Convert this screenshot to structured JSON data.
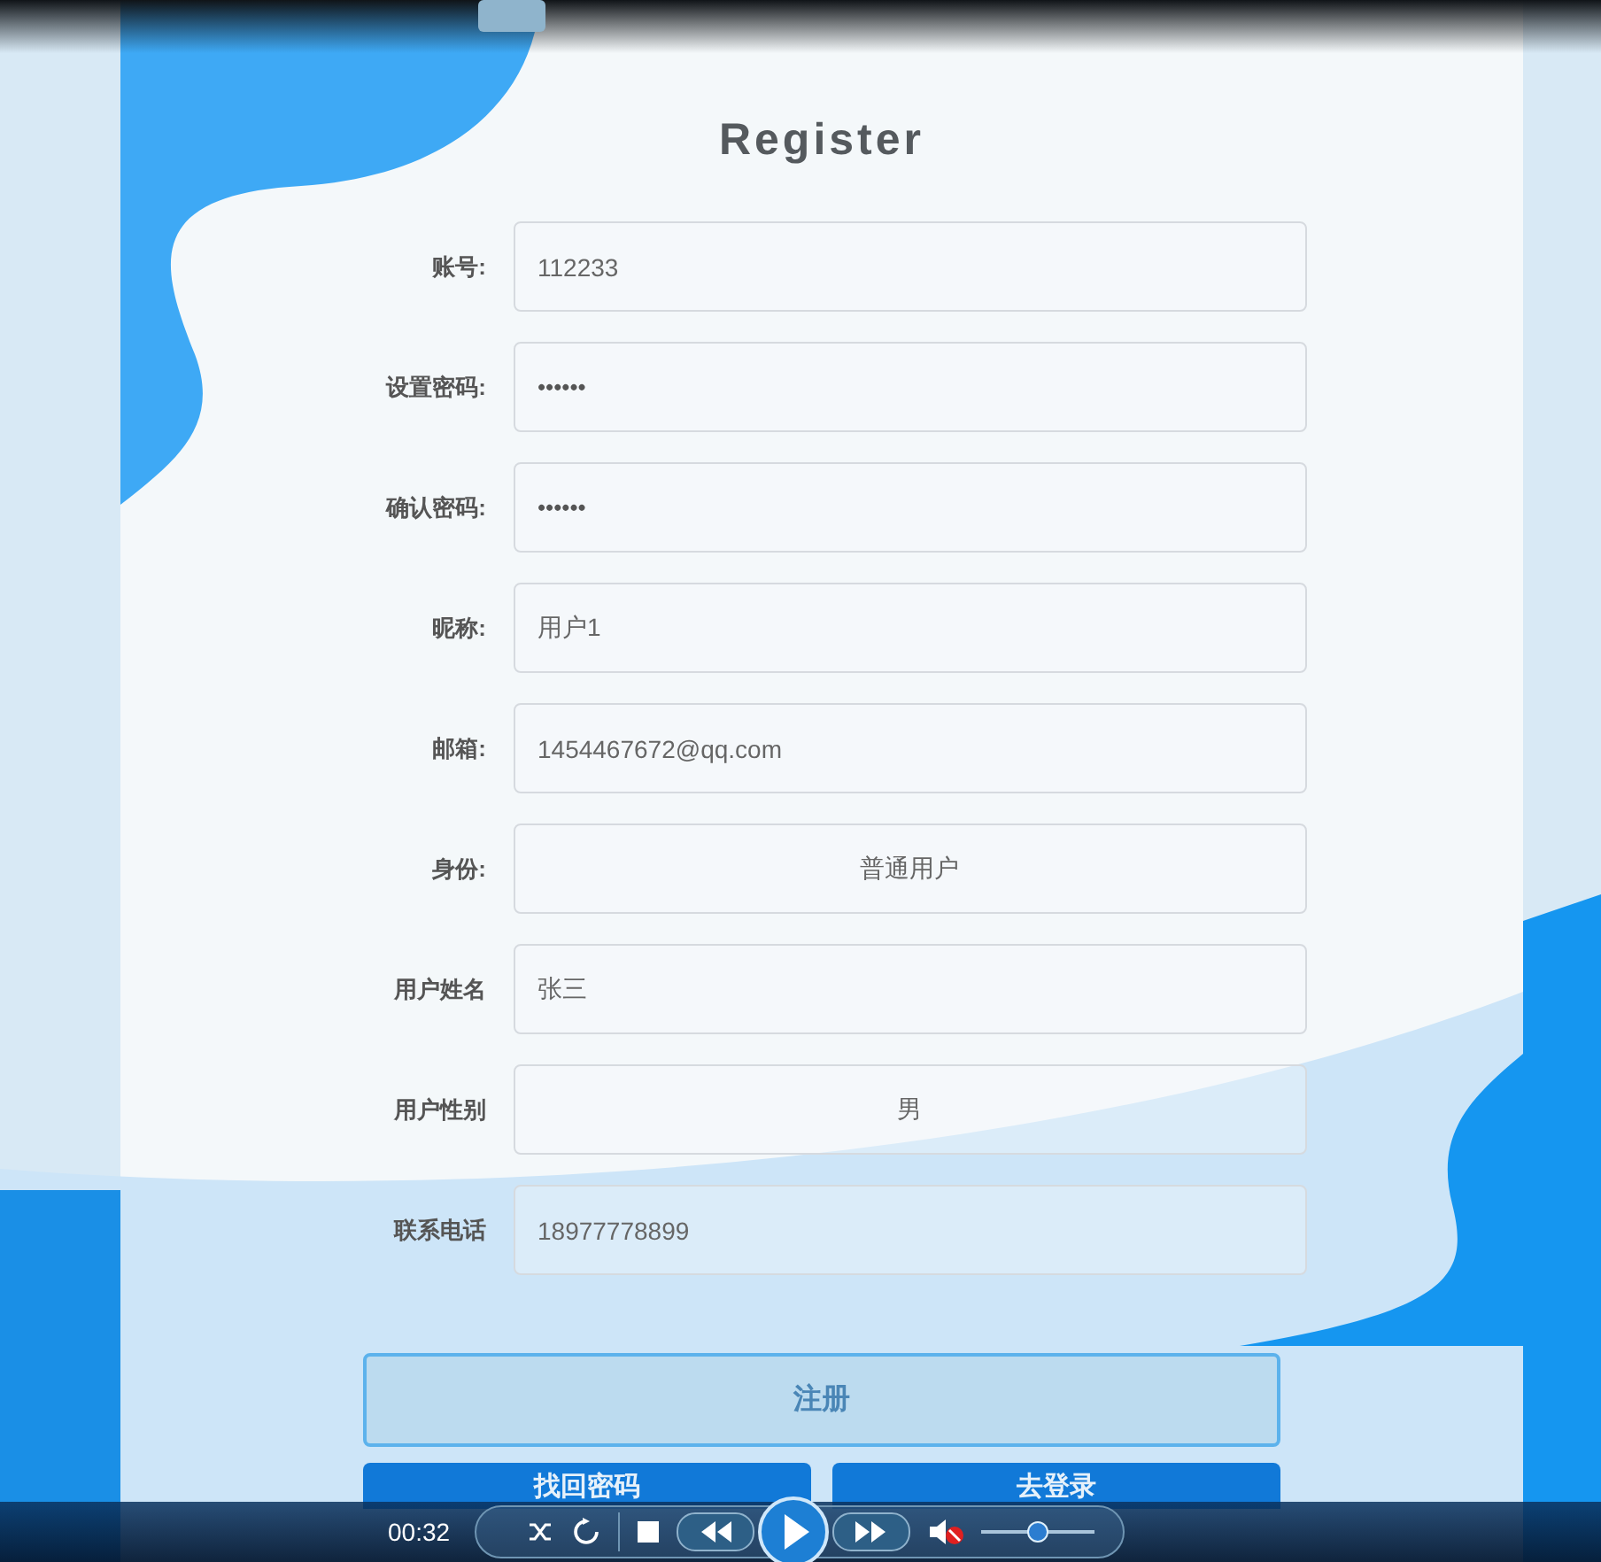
{
  "title": "Register",
  "fields": [
    {
      "kind": "text",
      "label": "账号:",
      "value": "112233"
    },
    {
      "kind": "password",
      "label": "设置密码:",
      "value": "••••••"
    },
    {
      "kind": "password",
      "label": "确认密码:",
      "value": "••••••"
    },
    {
      "kind": "text",
      "label": "昵称:",
      "value": "用户1"
    },
    {
      "kind": "text",
      "label": "邮箱:",
      "value": "1454467672@qq.com"
    },
    {
      "kind": "select",
      "label": "身份:",
      "value": "普通用户"
    },
    {
      "kind": "text",
      "label": "用户姓名",
      "value": "张三"
    },
    {
      "kind": "select",
      "label": "用户性别",
      "value": "男"
    },
    {
      "kind": "text",
      "label": "联系电话",
      "value": "18977778899"
    }
  ],
  "buttons": [
    {
      "kind": "primary",
      "label": "注册"
    },
    {
      "kind": "secondary",
      "label": "找回密码"
    },
    {
      "kind": "secondary",
      "label": "去登录"
    }
  ],
  "player": {
    "time": "00:32",
    "muted": true,
    "volume": {
      "level": 0.5
    }
  }
}
